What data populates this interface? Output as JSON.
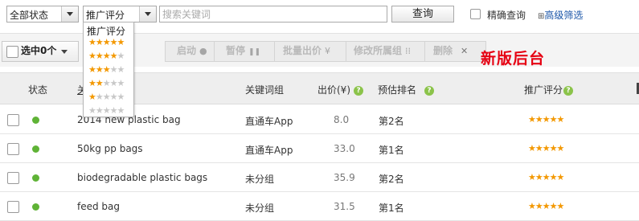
{
  "filters": {
    "status_select": "全部状态",
    "rating_select": "推广评分",
    "search_placeholder": "搜索关键词",
    "query_button": "查询",
    "exact_match_label": "精确查询",
    "advanced_filter_icon": "⊞",
    "advanced_filter_link": "高级筛选"
  },
  "rating_dropdown": {
    "header": "推广评分",
    "options": [
      {
        "on": "★★★★★",
        "off": "",
        "rating": 5
      },
      {
        "on": "★★★★",
        "off": "★",
        "rating": 4
      },
      {
        "on": "★★★",
        "off": "★★",
        "rating": 3
      },
      {
        "on": "★★",
        "off": "★★★",
        "rating": 2
      },
      {
        "on": "★",
        "off": "★★★★",
        "rating": 1
      },
      {
        "on": "",
        "off": "★★★★★",
        "rating": 0
      }
    ]
  },
  "toolbar": {
    "selected_label": "选中0个",
    "start_label": "启动",
    "start_icon": "●",
    "pause_label": "暂停",
    "pause_icon": "❚❚",
    "bulk_bid_label": "批量出价",
    "bulk_bid_icon": "¥",
    "change_group_label": "修改所属组",
    "change_group_icon": "⁞⁞",
    "delete_label": "删除",
    "delete_icon": "✕",
    "new_version_label": "新版后台"
  },
  "table": {
    "headers": {
      "status": "状态",
      "keyword": "关",
      "group": "关键词组",
      "bid": "出价(¥)",
      "rank": "预估排名",
      "rating": "推广评分",
      "help_icon": "?"
    },
    "rows": [
      {
        "keyword": "2014 new plastic bag",
        "group": "直通车App",
        "bid": "8.0",
        "rank": "第2名",
        "rating": "★★★★★"
      },
      {
        "keyword": "50kg pp bags",
        "group": "直通车App",
        "bid": "33.0",
        "rank": "第1名",
        "rating": "★★★★★"
      },
      {
        "keyword": "biodegradable plastic bags",
        "group": "未分组",
        "bid": "35.9",
        "rank": "第2名",
        "rating": "★★★★★"
      },
      {
        "keyword": "feed bag",
        "group": "未分组",
        "bid": "31.5",
        "rank": "第1名",
        "rating": "★★★★★"
      }
    ]
  }
}
